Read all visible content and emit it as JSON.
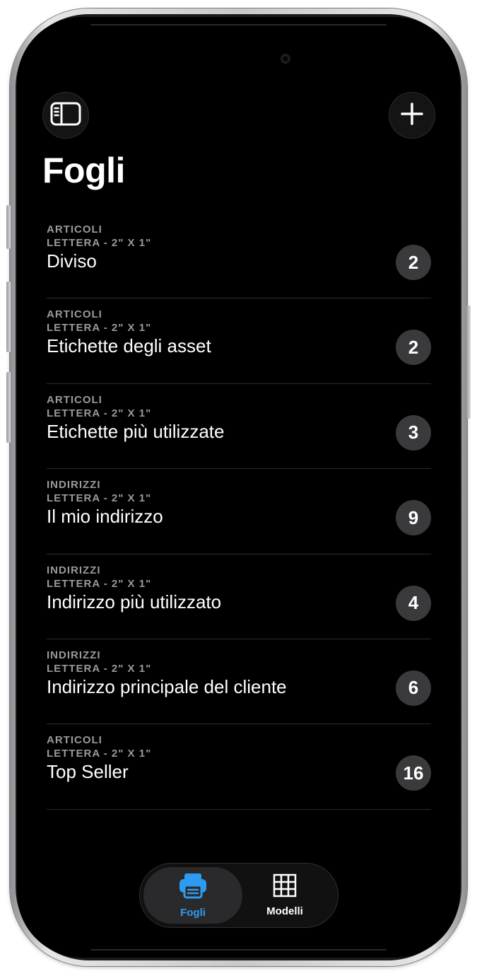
{
  "header": {
    "title": "Fogli",
    "sidebar_icon": "sidebar-icon",
    "add_icon": "plus-icon"
  },
  "sheets": [
    {
      "category": "ARTICOLI",
      "size": "LETTERA - 2\" X 1\"",
      "name": "Diviso",
      "count": "2"
    },
    {
      "category": "ARTICOLI",
      "size": "LETTERA - 2\" X 1\"",
      "name": "Etichette degli asset",
      "count": "2"
    },
    {
      "category": "ARTICOLI",
      "size": "LETTERA - 2\" X 1\"",
      "name": "Etichette più utilizzate",
      "count": "3"
    },
    {
      "category": "INDIRIZZI",
      "size": "LETTERA - 2\" X 1\"",
      "name": "Il mio indirizzo",
      "count": "9"
    },
    {
      "category": "INDIRIZZI",
      "size": "LETTERA - 2\" X 1\"",
      "name": "Indirizzo più utilizzato",
      "count": "4"
    },
    {
      "category": "INDIRIZZI",
      "size": "LETTERA - 2\" X 1\"",
      "name": "Indirizzo principale del cliente",
      "count": "6"
    },
    {
      "category": "ARTICOLI",
      "size": "LETTERA - 2\" X 1\"",
      "name": "Top Seller",
      "count": "16"
    }
  ],
  "tabs": [
    {
      "label": "Fogli",
      "icon": "printer-icon",
      "active": true
    },
    {
      "label": "Modelli",
      "icon": "grid-icon",
      "active": false
    }
  ],
  "colors": {
    "background": "#000000",
    "accent": "#2f9bf0",
    "badge": "#3a3a3c",
    "secondary_text": "#9a9a9e"
  }
}
